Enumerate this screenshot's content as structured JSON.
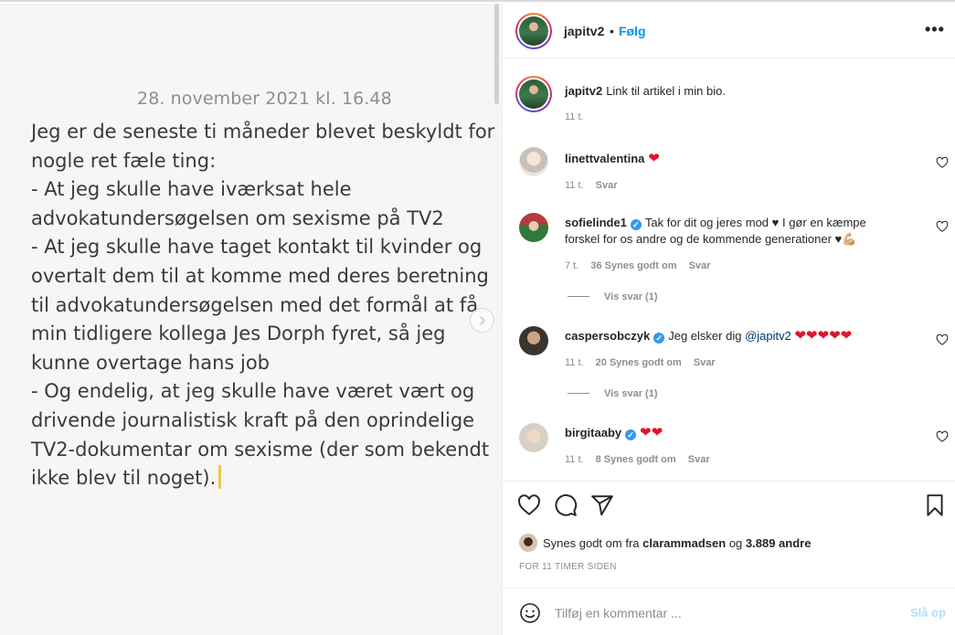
{
  "post": {
    "date_line": "28. november 2021 kl. 16.48",
    "body_lines": [
      "Jeg er de seneste ti måneder blevet beskyldt for",
      "nogle ret fæle ting:",
      "- At jeg skulle have iværksat hele",
      "advokatundersøgelsen om sexisme på TV2",
      "- At jeg skulle have taget kontakt til kvinder og",
      "overtalt dem til at komme med deres beretning",
      "til advokatundersøgelsen med det formål at få",
      "min tidligere kollega Jes Dorph fyret, så jeg",
      "kunne overtage hans job",
      "- Og endelig, at jeg skulle have været vært og",
      "drivende journalistisk kraft på den oprindelige",
      "TV2-dokumentar om sexisme (der som bekendt",
      "ikke blev til noget)."
    ]
  },
  "header": {
    "username": "japitv2",
    "dot": "•",
    "follow_label": "Følg",
    "more_icon": "more-horizontal-icon"
  },
  "caption": {
    "username": "japitv2",
    "text": "Link til artikel i min bio.",
    "time": "11 t."
  },
  "comments": [
    {
      "username": "linettvalentina",
      "verified": false,
      "text": "",
      "hearts": "❤",
      "time": "11 t.",
      "likes": "",
      "reply": "Svar",
      "view_replies": ""
    },
    {
      "username": "sofielinde1",
      "verified": true,
      "text_1": "Tak for dit og jeres mod ♥ I gør en kæmpe",
      "text_2": "forskel for os andre og de kommende generationer ♥",
      "emoji": "💪🏼",
      "time": "7 t.",
      "likes": "36 Synes godt om",
      "reply": "Svar",
      "view_replies": "Vis svar (1)"
    },
    {
      "username": "caspersobczyk",
      "verified": true,
      "text": "Jeg elsker dig",
      "mention": "@japitv2",
      "hearts": "❤❤❤❤❤",
      "time": "11 t.",
      "likes": "20 Synes godt om",
      "reply": "Svar",
      "view_replies": "Vis svar (1)"
    },
    {
      "username": "birgitaaby",
      "verified": true,
      "text": "",
      "hearts": "❤❤",
      "time": "11 t.",
      "likes": "8 Synes godt om",
      "reply": "Svar",
      "view_replies": ""
    }
  ],
  "likes": {
    "prefix": "Synes godt om fra",
    "user": "clarammadsen",
    "conj": "og",
    "others": "3.889 andre"
  },
  "timestamp": "FOR 11 TIMER SIDEN",
  "add_comment": {
    "placeholder": "Tilføj en kommentar ...",
    "post_label": "Slå op"
  },
  "colors": {
    "accent": "#0095f6",
    "heart": "#e0142c",
    "verified": "#3897f0"
  }
}
